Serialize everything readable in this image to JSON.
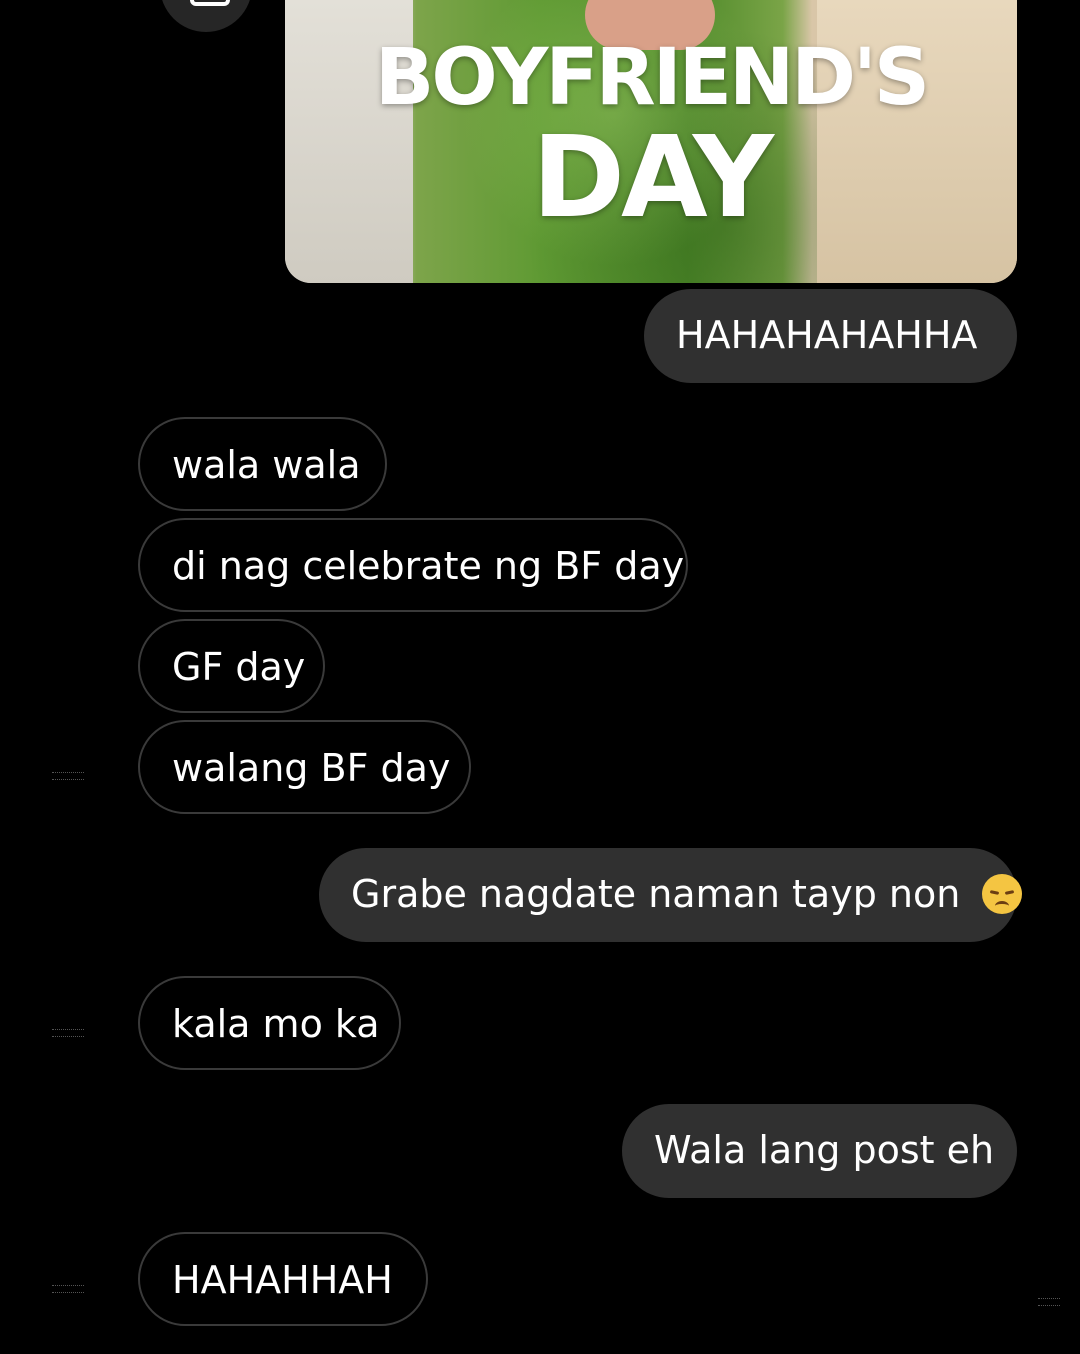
{
  "conversation": {
    "shared_image": {
      "title_line1": "BOYFRIEND'S",
      "title_line2": "DAY"
    },
    "messages": [
      {
        "side": "out",
        "text": "HAHAHAHAHHA"
      },
      {
        "side": "in",
        "text": "wala wala"
      },
      {
        "side": "in",
        "text": "di nag celebrate ng BF day"
      },
      {
        "side": "in",
        "text": "GF day"
      },
      {
        "side": "in",
        "text": "walang BF day"
      },
      {
        "side": "out",
        "text": "Grabe nagdate naman tayp non",
        "emoji": "disappointed-face"
      },
      {
        "side": "in",
        "text": "kala mo ka"
      },
      {
        "side": "out",
        "text": "Wala lang post eh"
      },
      {
        "side": "in",
        "text": "HAHAHHAH"
      }
    ]
  },
  "colors": {
    "background": "#000000",
    "outgoing_bubble": "#303030",
    "incoming_border": "#3a3a3a",
    "text": "#ffffff"
  }
}
